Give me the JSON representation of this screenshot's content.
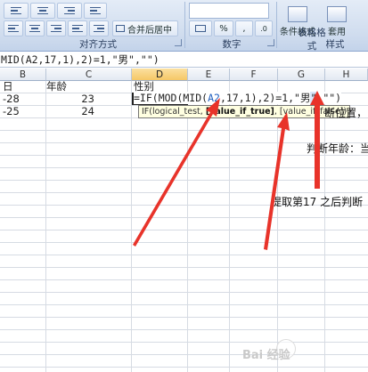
{
  "ribbon": {
    "merge_center_label": "合并后居中",
    "alignment_group_label": "对齐方式",
    "number_group_label": "数字",
    "percent_symbol": "%",
    "comma_symbol": ",",
    "conditional_format_label": "条件格式",
    "table_format_label": "表格格式",
    "apply_label": "套用",
    "styles_group_label": "样式"
  },
  "formula_bar": {
    "text": "MID(A2,17,1),2)=1,\"男\",\"\")"
  },
  "columns": {
    "headers": [
      "B",
      "C",
      "D",
      "E",
      "F",
      "G",
      "H"
    ]
  },
  "rows": [
    {
      "b": "日",
      "c": "年龄",
      "d": "性别"
    },
    {
      "b": "-28",
      "c": "23"
    },
    {
      "b": "-25",
      "c": "24"
    }
  ],
  "cell_edit": {
    "prefix": "=IF(MOD(MID(",
    "ref": "A2",
    "middle": ",17,1),2)=1,\"男",
    "mark": "\"",
    "suffix": ",\"\")"
  },
  "tooltip": {
    "fn": "IF(logical_test, ",
    "bold_arg": "[value_if_true]",
    "rest": ", [value_if_false])"
  },
  "annotations": {
    "pos_text": "断位置，",
    "age_text": "判断年龄：当前",
    "extract_text": "提取第17 之后判断"
  },
  "watermark": "Bai 经验",
  "colors": {
    "arrow": "#e8332a",
    "ribbon_bg": "#d5e1f2",
    "active_header": "#f5c766"
  },
  "icons": [
    "align-left-icon",
    "align-center-icon",
    "align-right-icon",
    "indent-icon",
    "merge-center-icon",
    "percent-icon",
    "comma-icon",
    "conditional-format-icon",
    "table-format-icon",
    "dialog-launcher-icon"
  ]
}
